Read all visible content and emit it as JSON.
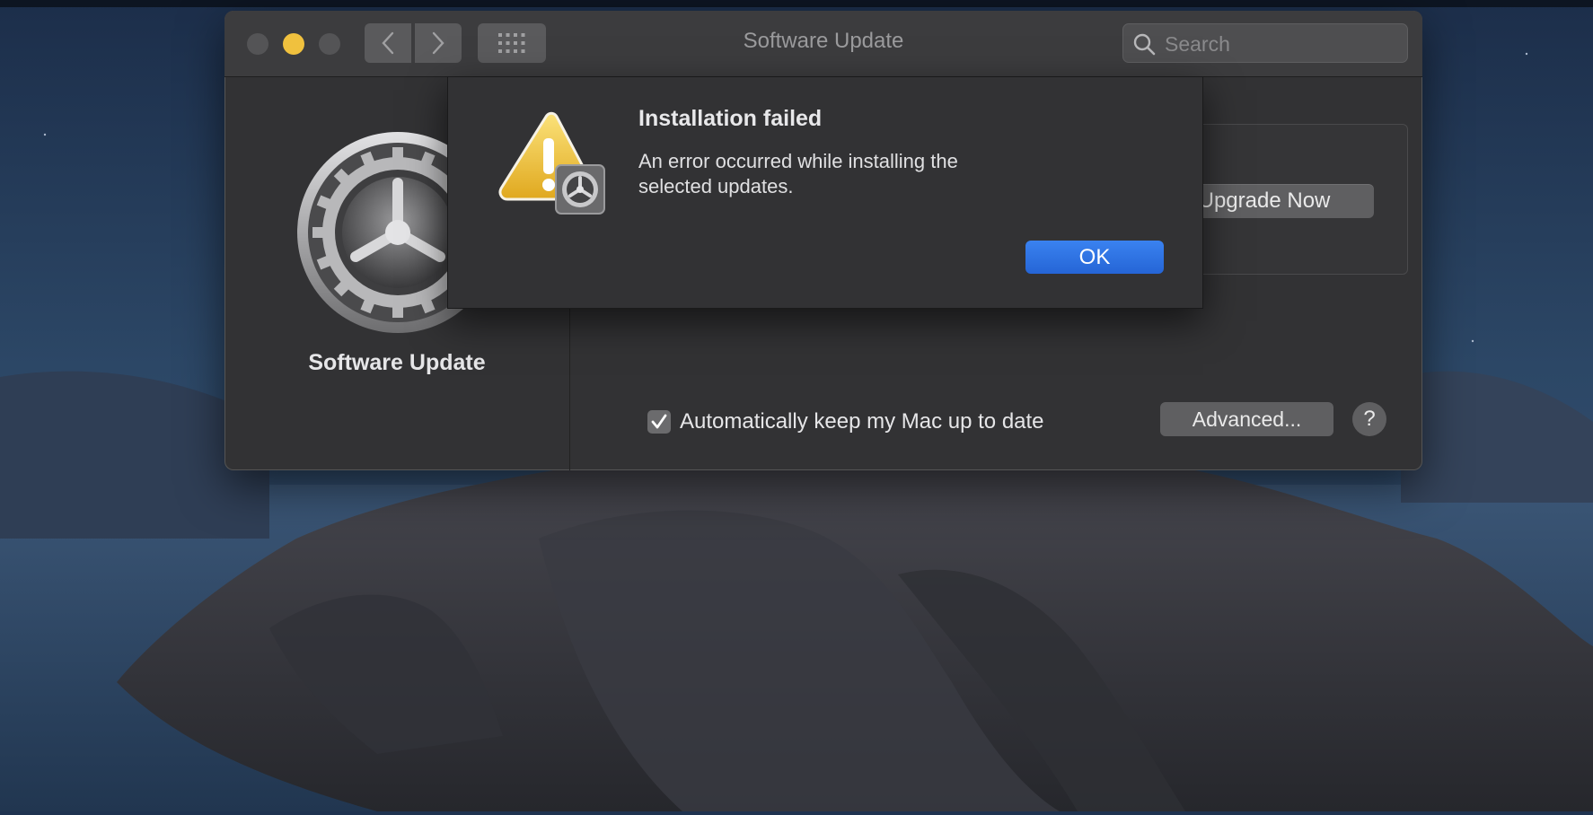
{
  "window": {
    "title": "Software Update",
    "search": {
      "placeholder": "Search",
      "value": ""
    }
  },
  "sidebar": {
    "title": "Software Update"
  },
  "content": {
    "upgrade_button_label": "Upgrade Now",
    "auto_update": {
      "label": "Automatically keep my Mac up to date",
      "checked": true
    },
    "advanced_button_label": "Advanced...",
    "help_button_label": "?"
  },
  "alert": {
    "title": "Installation failed",
    "message": "An error occurred while installing the selected updates.",
    "ok_label": "OK"
  },
  "colors": {
    "accent": "#2565d6",
    "minimize": "#f0c13e",
    "warning": "#f2c12e"
  }
}
